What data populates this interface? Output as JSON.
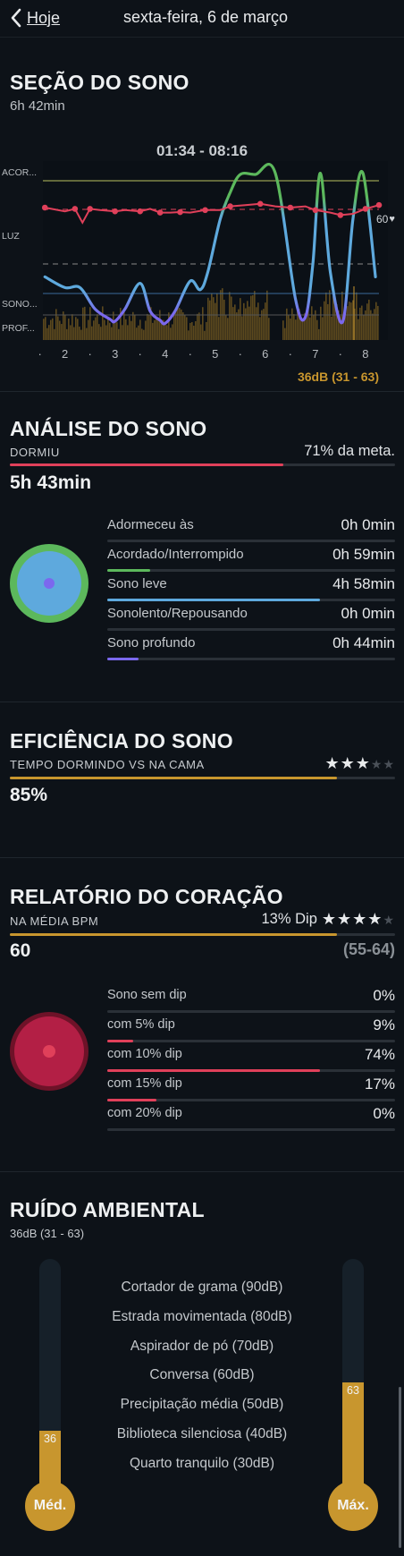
{
  "header": {
    "back_label": "Hoje",
    "title": "sexta-feira, 6 de março"
  },
  "sleep_section": {
    "title": "SEÇÃO DO SONO",
    "duration": "6h 42min",
    "time_range": "01:34 - 08:16",
    "stage_labels": [
      "ACOR...",
      "LUZ",
      "SONO...",
      "PROF..."
    ],
    "x_ticks": [
      "2",
      "3",
      "4",
      "5",
      "6",
      "7",
      "8"
    ],
    "hr_now": "60",
    "noise_summary": "36dB (31 - 63)"
  },
  "chart_data": {
    "type": "line",
    "x_range": [
      1.56,
      8.27
    ],
    "x_ticks": [
      "2",
      "3",
      "4",
      "5",
      "6",
      "7",
      "8"
    ],
    "stages": [
      "ACOR...",
      "LUZ",
      "SONO...",
      "PROF..."
    ],
    "series": [
      {
        "points": [
          [
            1.6,
            1.3
          ],
          [
            2.0,
            1.55
          ],
          [
            2.3,
            1.55
          ],
          [
            2.6,
            2.1
          ],
          [
            2.9,
            2.6
          ],
          [
            3.0,
            2.7
          ],
          [
            3.2,
            2.1
          ],
          [
            3.5,
            1.45
          ],
          [
            3.7,
            2.2
          ],
          [
            3.9,
            2.65
          ],
          [
            4.0,
            2.8
          ],
          [
            4.2,
            2.2
          ],
          [
            4.5,
            1.4
          ],
          [
            4.7,
            1.6
          ],
          [
            4.85,
            1.2
          ],
          [
            5.1,
            0.5
          ],
          [
            5.3,
            0.2
          ],
          [
            5.5,
            0.0
          ],
          [
            5.8,
            0.0
          ],
          [
            6.2,
            -0.05
          ],
          [
            6.6,
            1.8
          ],
          [
            6.8,
            2.5
          ],
          [
            6.95,
            1.0
          ],
          [
            7.1,
            -0.05
          ],
          [
            7.3,
            1.2
          ],
          [
            7.55,
            2.7
          ],
          [
            7.75,
            0.5
          ],
          [
            7.95,
            -0.05
          ],
          [
            8.2,
            1.3
          ]
        ]
      },
      {
        "points": [
          [
            1.6,
            1.0
          ],
          [
            2.0,
            0.85
          ],
          [
            2.2,
            0.95
          ],
          [
            2.35,
            0.4
          ],
          [
            2.5,
            0.95
          ],
          [
            2.7,
            0.9
          ],
          [
            3.0,
            0.85
          ],
          [
            3.2,
            0.9
          ],
          [
            3.5,
            0.85
          ],
          [
            3.7,
            0.95
          ],
          [
            3.9,
            0.8
          ],
          [
            4.1,
            0.8
          ],
          [
            4.3,
            0.82
          ],
          [
            4.5,
            0.8
          ],
          [
            4.8,
            0.9
          ],
          [
            5.1,
            0.9
          ],
          [
            5.3,
            1.05
          ],
          [
            5.6,
            1.1
          ],
          [
            5.9,
            1.15
          ],
          [
            6.2,
            1.05
          ],
          [
            6.5,
            1.0
          ],
          [
            6.8,
            1.05
          ],
          [
            7.0,
            0.9
          ],
          [
            7.3,
            0.8
          ],
          [
            7.5,
            0.7
          ],
          [
            7.75,
            0.75
          ],
          [
            8.0,
            0.95
          ],
          [
            8.27,
            1.1
          ]
        ]
      }
    ],
    "noise": {
      "min_db": 31,
      "max_db": 63,
      "avg_db": 36
    }
  },
  "analysis": {
    "title": "ANÁLISE DO SONO",
    "subtitle": "DORMIU",
    "goal_text": "71% da meta.",
    "goal_fraction": 0.71,
    "total": "5h 43min",
    "rows": [
      {
        "label": "Adormeceu às",
        "value": "0h 0min",
        "fraction": 0,
        "color": "#6ab04c"
      },
      {
        "label": "Acordado/Interrompido",
        "value": "0h 59min",
        "fraction": 0.15,
        "color": "#5cb85c"
      },
      {
        "label": "Sono leve",
        "value": "4h 58min",
        "fraction": 0.74,
        "color": "#5ea9dd"
      },
      {
        "label": "Sonolento/Repousando",
        "value": "0h 0min",
        "fraction": 0,
        "color": "#5ea9dd"
      },
      {
        "label": "Sono profundo",
        "value": "0h 44min",
        "fraction": 0.11,
        "color": "#7b68ee"
      }
    ]
  },
  "efficiency": {
    "title": "EFICIÊNCIA DO SONO",
    "subtitle": "TEMPO DORMINDO VS NA CAMA",
    "value": "85%",
    "fraction": 0.85,
    "stars_filled": 3,
    "stars_total": 5
  },
  "heart": {
    "title": "RELATÓRIO DO CORAÇÃO",
    "subtitle": "NA MÉDIA BPM",
    "dip_text": "13% Dip",
    "avg": "60",
    "range": "(55-64)",
    "stars_filled": 4,
    "stars_total": 5,
    "fraction": 0.85,
    "rows": [
      {
        "label": "Sono sem dip",
        "value": "0%",
        "fraction": 0
      },
      {
        "label": "com 5% dip",
        "value": "9%",
        "fraction": 0.09
      },
      {
        "label": "com 10% dip",
        "value": "74%",
        "fraction": 0.74
      },
      {
        "label": "com 15% dip",
        "value": "17%",
        "fraction": 0.17
      },
      {
        "label": "com 20% dip",
        "value": "0%",
        "fraction": 0
      }
    ]
  },
  "noise": {
    "title": "RUÍDO AMBIENTAL",
    "subtitle": "36dB (31 - 63)",
    "items": [
      "Cortador de grama (90dB)",
      "Estrada movimentada (80dB)",
      "Aspirador de pó (70dB)",
      "Conversa (60dB)",
      "Precipitação média (50dB)",
      "Biblioteca silenciosa (40dB)",
      "Quarto tranquilo (30dB)"
    ],
    "avg_value": "36",
    "max_value": "63",
    "avg_label": "Méd.",
    "max_label": "Máx."
  },
  "colors": {
    "accent_gold": "#c8962e",
    "red": "#e0405a",
    "blue": "#5ea9dd",
    "green": "#5cb85c",
    "purple": "#7b68ee"
  }
}
